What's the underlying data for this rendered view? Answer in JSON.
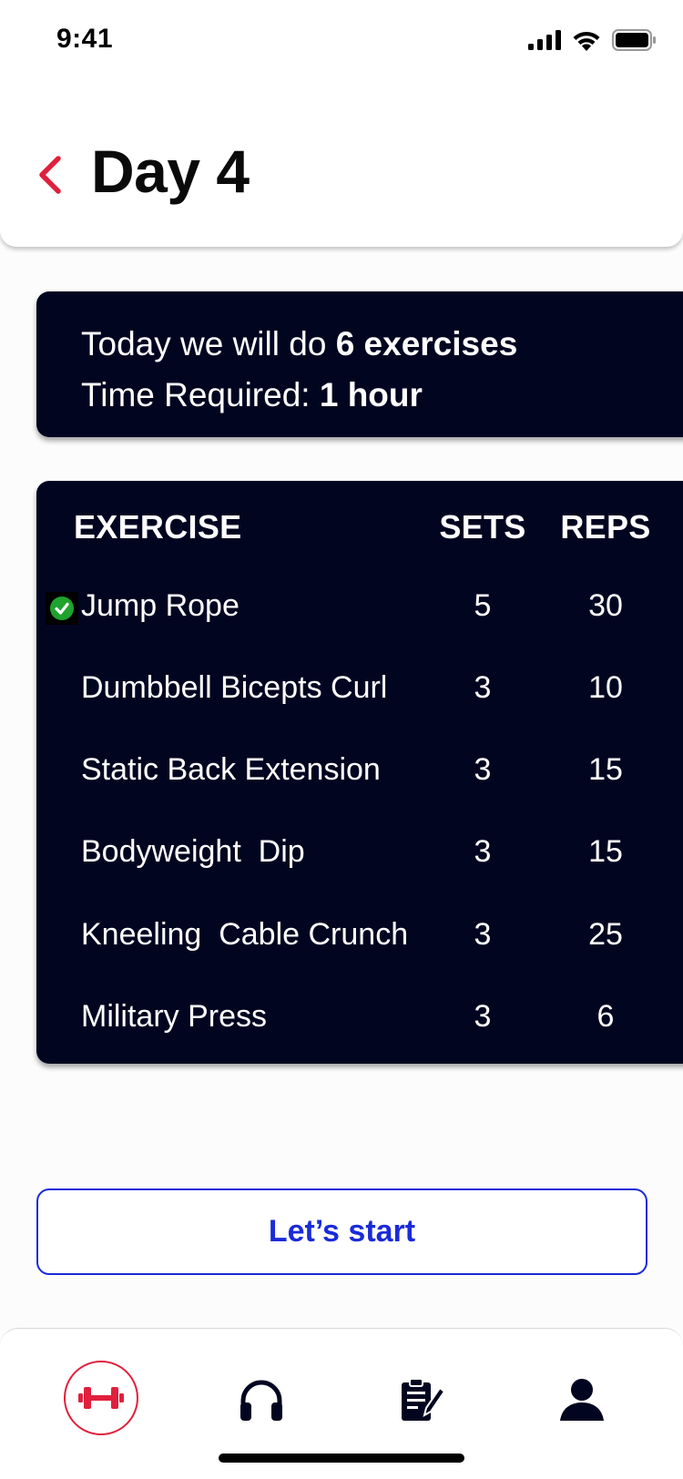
{
  "status_bar": {
    "time": "9:41"
  },
  "header": {
    "title": "Day 4"
  },
  "summary": {
    "line1_prefix": "Today we will do ",
    "line1_value": "6 exercises",
    "line2_prefix": "Time Required: ",
    "line2_value": "1 hour"
  },
  "table": {
    "headers": {
      "exercise": "EXERCISE",
      "sets": "SETS",
      "reps": "REPS"
    },
    "rows": [
      {
        "name": "Jump Rope",
        "sets": "5",
        "reps": "30",
        "completed": true
      },
      {
        "name": "Dumbbell Bicepts Curl",
        "sets": "3",
        "reps": "10",
        "completed": false
      },
      {
        "name": "Static Back Extension",
        "sets": "3",
        "reps": "15",
        "completed": false
      },
      {
        "name": "Bodyweight  Dip",
        "sets": "3",
        "reps": "15",
        "completed": false
      },
      {
        "name": "Kneeling  Cable Crunch",
        "sets": "3",
        "reps": "25",
        "completed": false
      },
      {
        "name": "Military Press",
        "sets": "3",
        "reps": "6",
        "completed": false
      }
    ]
  },
  "start_button": {
    "label": "Let’s start"
  },
  "tab_bar": {
    "tabs": [
      {
        "icon": "dumbbell-icon",
        "active": true
      },
      {
        "icon": "headphones-icon",
        "active": false
      },
      {
        "icon": "clipboard-edit-icon",
        "active": false
      },
      {
        "icon": "user-icon",
        "active": false
      }
    ]
  },
  "colors": {
    "accent_red": "#e0203c",
    "card_navy": "#020520",
    "button_blue": "#1a2bd8",
    "check_green": "#1fa32e"
  }
}
